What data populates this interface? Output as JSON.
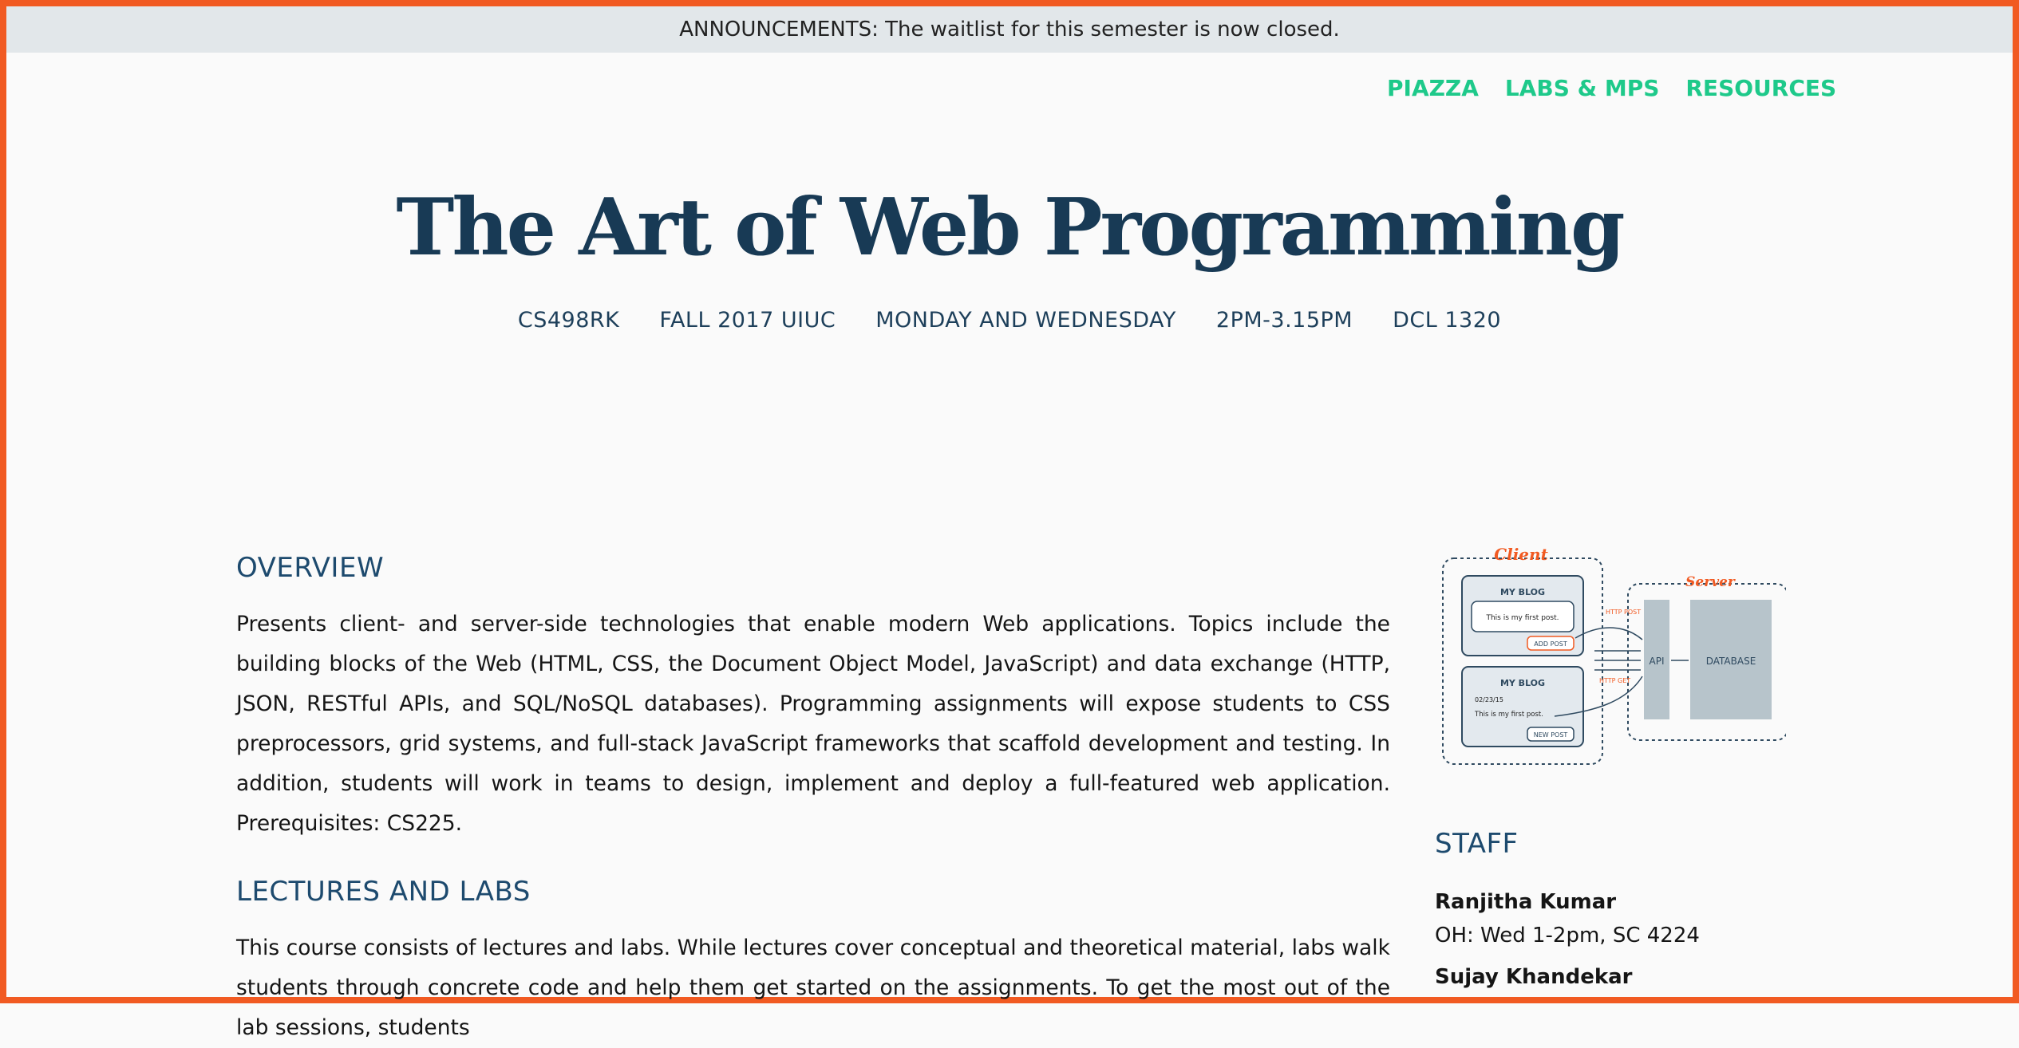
{
  "announcement": "ANNOUNCEMENTS: The waitlist for this semester is now closed.",
  "nav": {
    "items": [
      "PIAZZA",
      "LABS & MPS",
      "RESOURCES"
    ]
  },
  "hero": {
    "title": "The Art of Web Programming",
    "meta": [
      "CS498RK",
      "FALL 2017 UIUC",
      "MONDAY AND WEDNESDAY",
      "2PM-3.15PM",
      "DCL 1320"
    ]
  },
  "overview": {
    "heading": "OVERVIEW",
    "text": "Presents client- and server-side technologies that enable modern Web applications. Topics include the building blocks of the Web (HTML, CSS, the Document Object Model, JavaScript) and data exchange (HTTP, JSON, RESTful APIs, and SQL/NoSQL databases). Programming assignments will expose students to CSS preprocessors, grid systems, and full-stack JavaScript frameworks that scaffold development and testing. In addition, students will work in teams to design, implement and deploy a full-featured web application. Prerequisites: CS225."
  },
  "lectures": {
    "heading": "LECTURES AND LABS",
    "text": "This course consists of lectures and labs. While lectures cover conceptual and theoretical material, labs walk students through concrete code and help them get started on the assignments. To get the most out of the lab sessions, students"
  },
  "diagram": {
    "client_label": "Client",
    "server_label": "Server",
    "blog_title_1": "MY BLOG",
    "post_text_1": "This is my first post.",
    "add_post": "ADD POST",
    "blog_title_2": "MY BLOG",
    "date": "02/23/15",
    "post_text_2": "This is my first post.",
    "new_post": "NEW POST",
    "http_post": "HTTP POST",
    "http_get": "HTTP GET",
    "api": "API",
    "database": "DATABASE",
    "colors": {
      "accent": "#f15a22",
      "dark": "#2f4a60",
      "box": "#b7c4cb"
    }
  },
  "staff": {
    "heading": "STAFF",
    "members": [
      {
        "name": "Ranjitha Kumar",
        "oh": "OH: Wed 1-2pm, SC 4224"
      },
      {
        "name": "Sujay Khandekar"
      }
    ]
  },
  "colors": {
    "nav": "#1ec98a",
    "title": "#183a55",
    "frame": "#f15a22",
    "banner": "#e2e7ea"
  }
}
